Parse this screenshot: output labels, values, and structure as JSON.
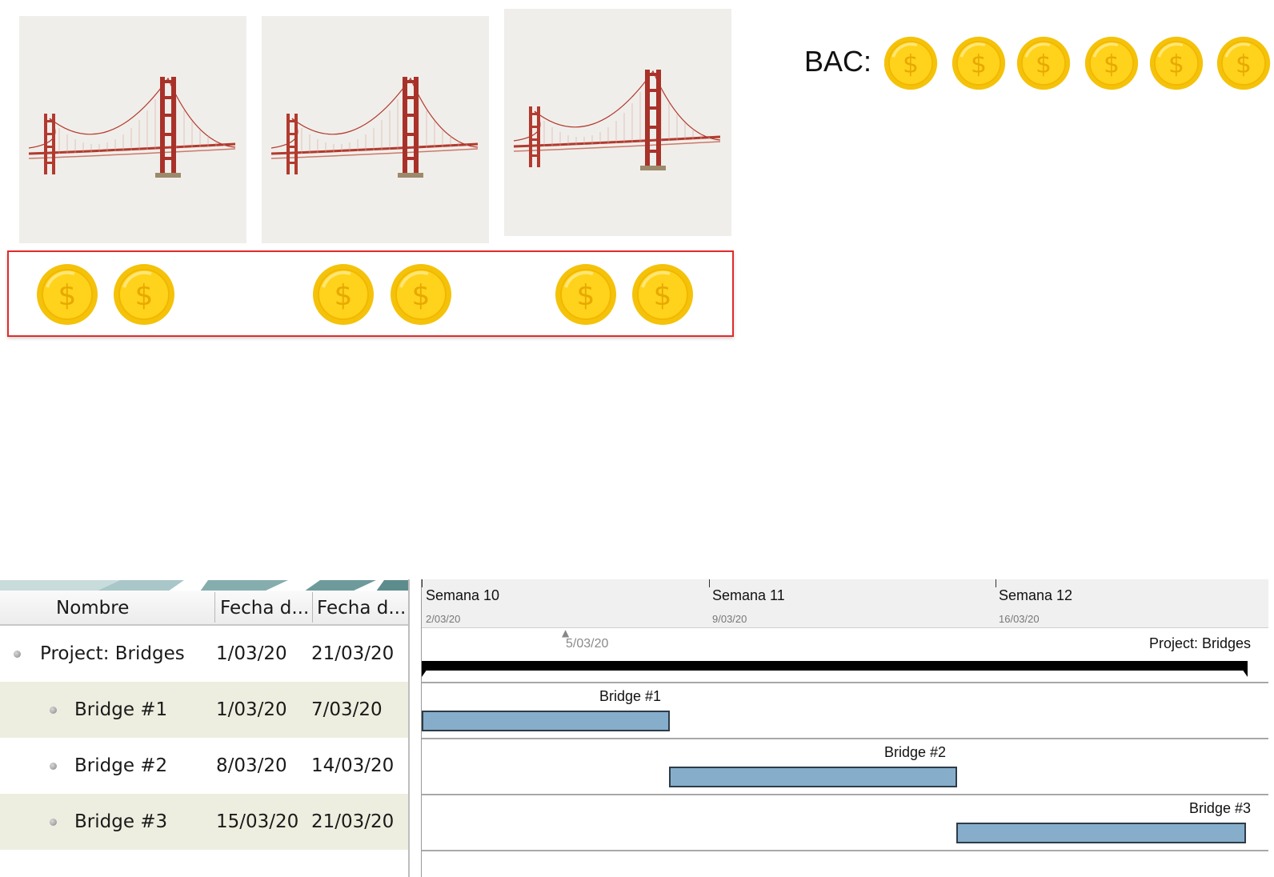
{
  "bac": {
    "label": "BAC:"
  },
  "bridge_images": [
    {
      "name": "Bridge image 1"
    },
    {
      "name": "Bridge image 2"
    },
    {
      "name": "Bridge image 3"
    }
  ],
  "coin_symbol": "$",
  "gantt": {
    "columns": {
      "name": "Nombre",
      "start": "Fecha d...",
      "end": "Fecha d..."
    },
    "tasks": [
      {
        "name": "Project: Bridges",
        "start": "1/03/20",
        "end": "21/03/20"
      },
      {
        "name": "Bridge #1",
        "start": "1/03/20",
        "end": "7/03/20"
      },
      {
        "name": "Bridge #2",
        "start": "8/03/20",
        "end": "14/03/20"
      },
      {
        "name": "Bridge #3",
        "start": "15/03/20",
        "end": "21/03/20"
      }
    ],
    "weeks": [
      {
        "label": "Semana 10",
        "date": "2/03/20"
      },
      {
        "label": "Semana 11",
        "date": "9/03/20"
      },
      {
        "label": "Semana 12",
        "date": "16/03/20"
      }
    ],
    "today": "5/03/20",
    "bars": [
      {
        "label": "Project: Bridges"
      },
      {
        "label": "Bridge #1"
      },
      {
        "label": "Bridge #2"
      },
      {
        "label": "Bridge #3"
      }
    ]
  }
}
